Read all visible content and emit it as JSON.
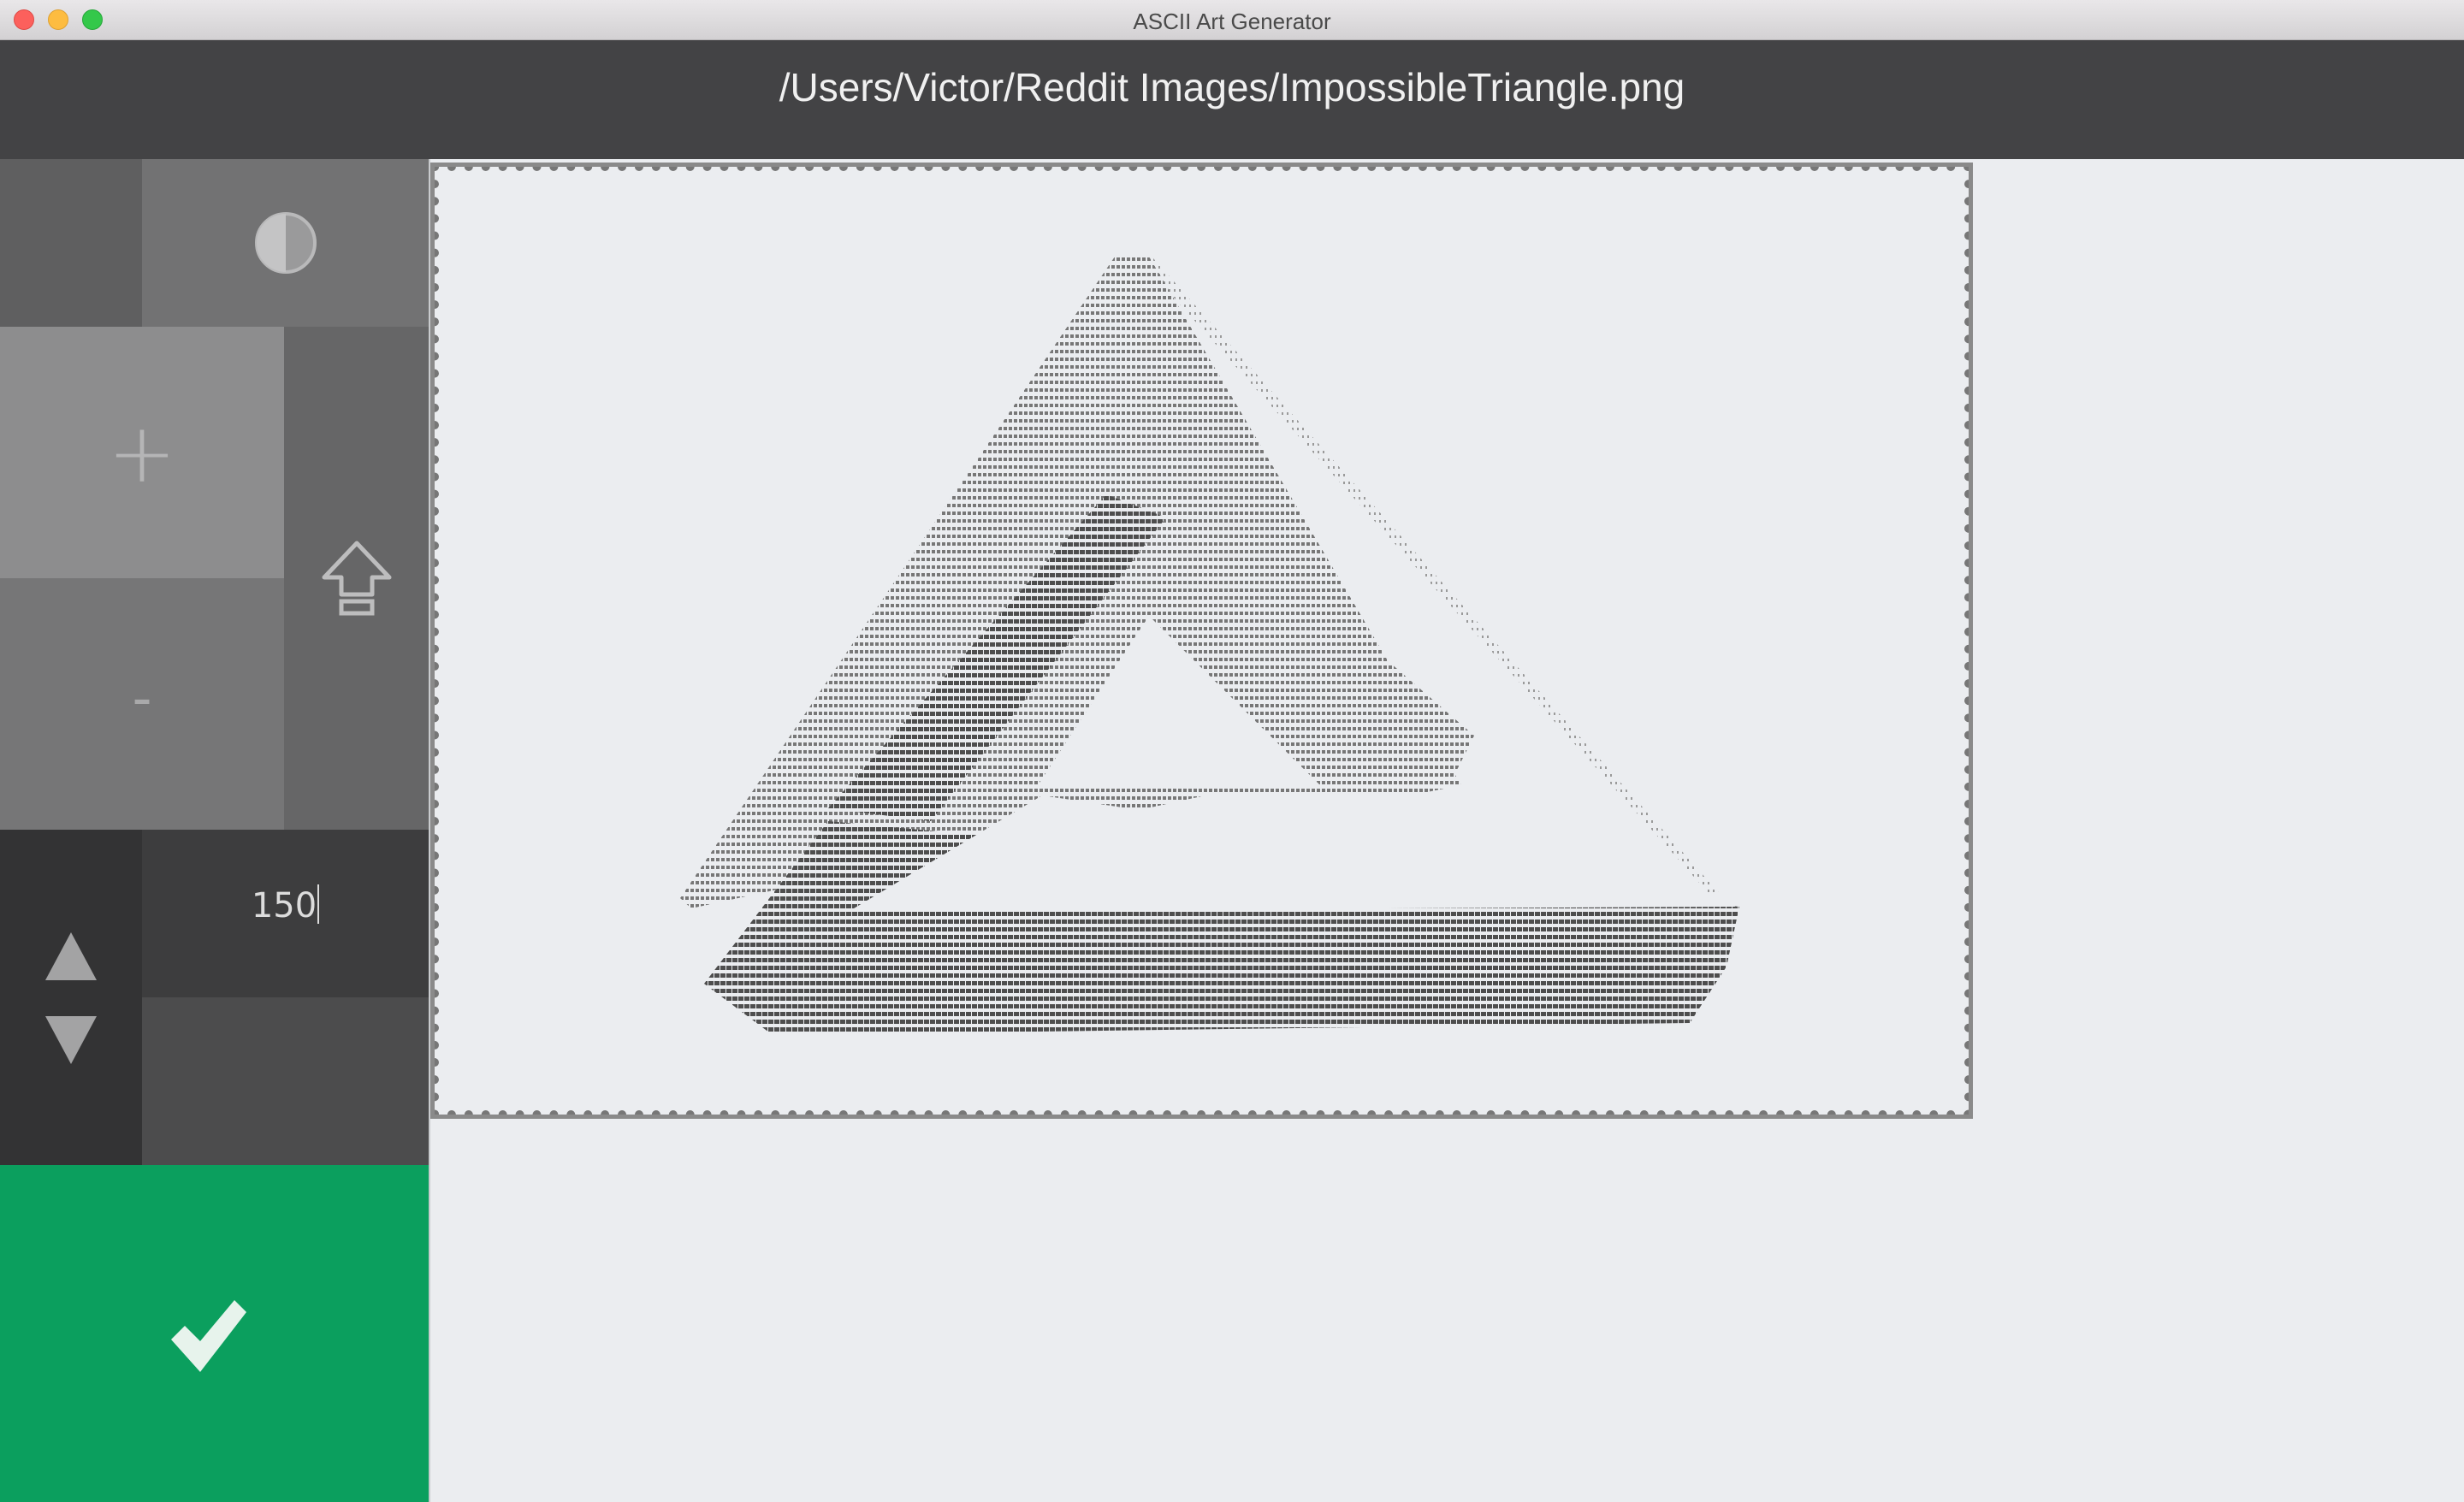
{
  "window": {
    "title": "ASCII Art Generator"
  },
  "header": {
    "file_path": "/Users/Victor/Reddit Images/ImpossibleTriangle.png"
  },
  "sidebar": {
    "contrast_icon": "contrast-icon",
    "plus_symbol": "+",
    "minus_symbol": "-",
    "shift_icon": "shift-arrow-icon",
    "arrow_up_icon": "arrow-up-icon",
    "arrow_down_icon": "arrow-down-icon",
    "width_value": "150",
    "confirm_icon": "checkmark-icon"
  },
  "colors": {
    "header_bg": "#434345",
    "confirm_green": "#0b9f5e",
    "canvas_bg": "#ebedf0"
  },
  "preview": {
    "art_subject": "impossible-triangle-ascii-render"
  }
}
